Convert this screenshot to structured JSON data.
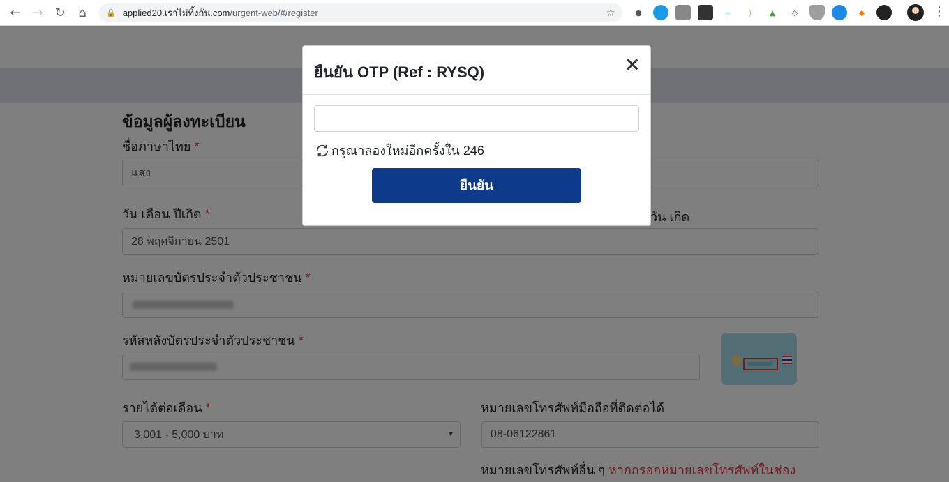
{
  "browser": {
    "url_host": "applied20.เราไม่ทิ้งกัน.com",
    "url_path": "/urgent-web/#/register",
    "nav_back": "←",
    "nav_forward": "→",
    "nav_reload": "↻",
    "nav_home": "⌂",
    "star": "☆",
    "menu": "⋮"
  },
  "form": {
    "section_title": "ข้อมูลผู้ลงทะเบียน",
    "thai_name_label": "ชื่อภาษาไทย",
    "thai_name_value": "แสง",
    "birth_label": "วัน เดือน ปีเกิด",
    "birth_value": "28 พฤศจิกายน 2501",
    "birth_right_label": "วัน เกิด",
    "id_label": "หมายเลขบัตรประจำตัวประชาชน",
    "laser_label": "รหัสหลังบัตรประจำตัวประชาชน",
    "income_label": "รายได้ต่อเดือน",
    "income_value": "3,001 - 5,000 บาท",
    "mobile_label": "หมายเลขโทรศัพท์มือถือที่ติดต่อได้",
    "mobile_value": "08-06122861",
    "other_phone_label": "หมายเลขโทรศัพท์อื่น ๆ",
    "other_phone_note": "หากกรอกหมายเลขโทรศัพท์ในช่อง",
    "required_mark": "*"
  },
  "modal": {
    "title": "ยืนยัน OTP (Ref : RYSQ)",
    "close": "×",
    "retry_text": "กรุณาลองใหม่อีกครั้งใน 246",
    "confirm_label": "ยืนยัน"
  },
  "colors": {
    "primary_button": "#0e3a8c",
    "required": "#dc3545"
  }
}
